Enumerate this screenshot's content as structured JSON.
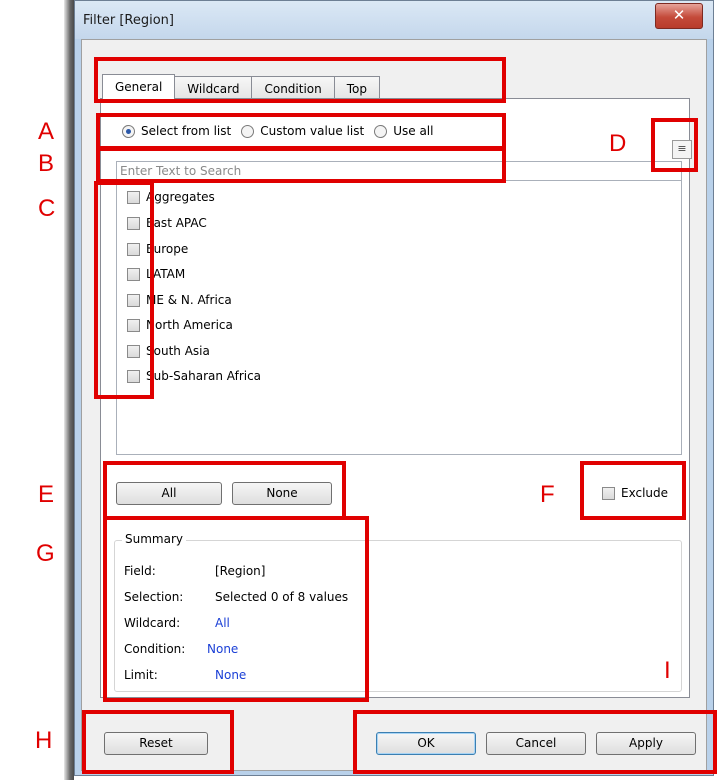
{
  "window": {
    "title": "Filter [Region]",
    "close_glyph": "✕"
  },
  "tabs": [
    {
      "label": "General",
      "active": true
    },
    {
      "label": "Wildcard",
      "active": false
    },
    {
      "label": "Condition",
      "active": false
    },
    {
      "label": "Top",
      "active": false
    }
  ],
  "radios": [
    {
      "label": "Select from list",
      "checked": true
    },
    {
      "label": "Custom value list",
      "checked": false
    },
    {
      "label": "Use all",
      "checked": false
    }
  ],
  "menu_icon": "≡",
  "search": {
    "placeholder": "Enter Text to Search"
  },
  "list_items": [
    "Aggregates",
    "East APAC",
    "Europe",
    "LATAM",
    "ME & N. Africa",
    "North America",
    "South Asia",
    "Sub-Saharan Africa"
  ],
  "buttons": {
    "all": "All",
    "none": "None",
    "reset": "Reset",
    "ok": "OK",
    "cancel": "Cancel",
    "apply": "Apply"
  },
  "exclude_label": "Exclude",
  "summary": {
    "title": "Summary",
    "rows": [
      {
        "label": "Field:",
        "value": "[Region]"
      },
      {
        "label": "Selection:",
        "value": "Selected 0 of 8 values"
      },
      {
        "label": "Wildcard:",
        "value": "All"
      },
      {
        "label": "Condition:",
        "value": "None"
      },
      {
        "label": "Limit:",
        "value": "None"
      }
    ]
  },
  "annotation_letters": [
    "A",
    "B",
    "C",
    "D",
    "E",
    "F",
    "G",
    "H",
    "I"
  ],
  "colors": {
    "annotation": "#e00000",
    "link_blue": "#1a3fd6",
    "close_red": "#c44a3a"
  }
}
